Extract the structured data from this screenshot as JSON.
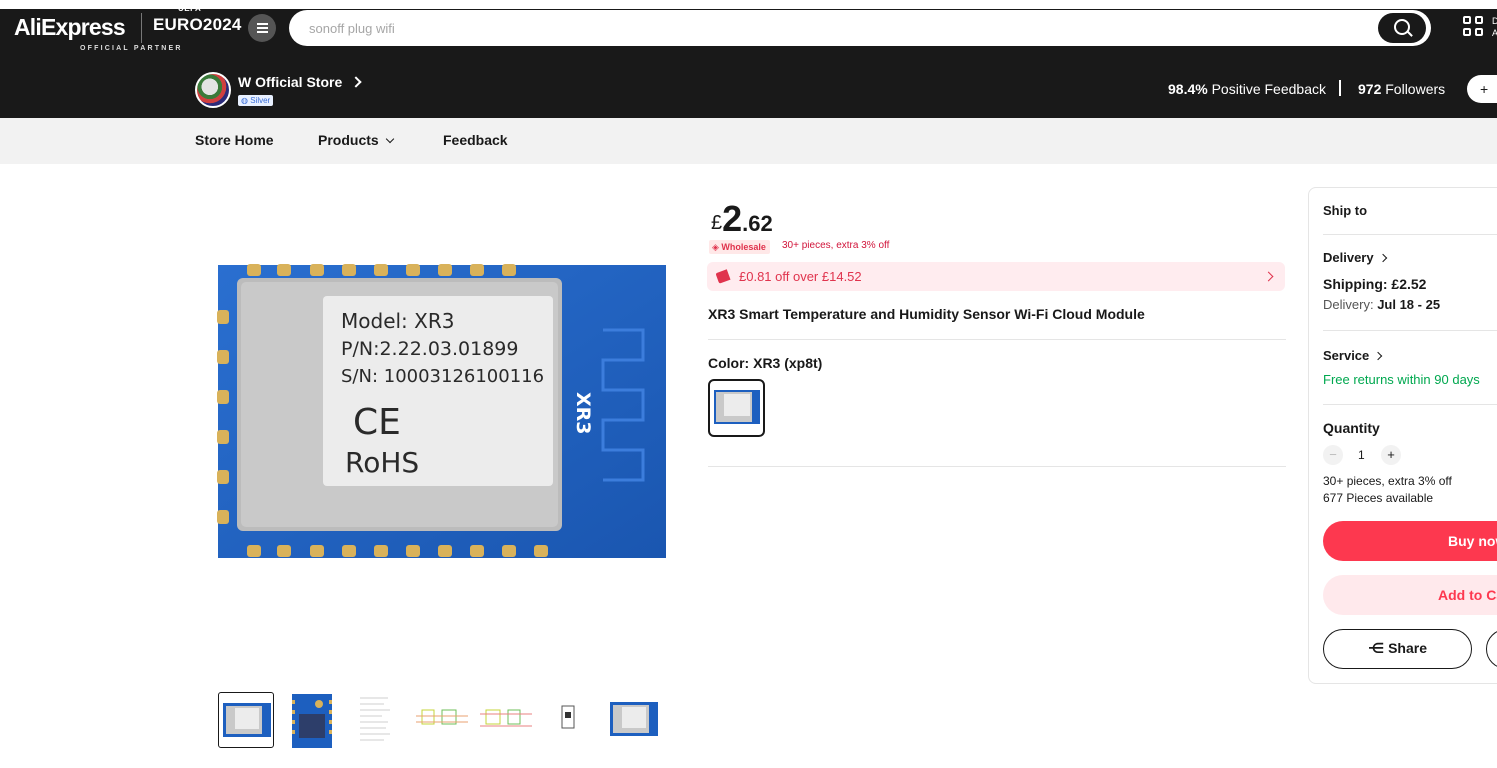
{
  "header": {
    "logo": "AliExpress",
    "euro": "EURO2024",
    "uefa": "UEFA",
    "partner": "OFFICIAL PARTNER",
    "search_placeholder": "sonoff plug wifi",
    "qr_text": "D A"
  },
  "store": {
    "name": "W Official Store",
    "badge": "Silver",
    "positive_feedback_value": "98.4%",
    "positive_feedback_label": "Positive Feedback",
    "followers_value": "972",
    "followers_label": "Followers",
    "follow_label": "+"
  },
  "nav": {
    "store_home": "Store Home",
    "products": "Products",
    "feedback": "Feedback"
  },
  "product": {
    "currency": "£",
    "price_int": "2",
    "price_dec": ".62",
    "wholesale_badge": "Wholesale",
    "wholesale_text": "30+ pieces, extra 3% off",
    "coupon_text": "£0.81 off over £14.52",
    "title": "XR3 Smart Temperature and Humidity Sensor Wi-Fi Cloud Module",
    "color_label": "Color: XR3 (xp8t)",
    "image_text": {
      "model": "Model: XR3",
      "pn": "P/N:2.22.03.01899",
      "sn": "S/N: 10003126100116",
      "ce": "CE",
      "rohs": "RoHS",
      "side": "XR3"
    }
  },
  "panel": {
    "ship_to": "Ship to",
    "delivery_label": "Delivery",
    "shipping": "Shipping: £2.52",
    "delivery_prefix": "Delivery: ",
    "delivery_dates": "Jul 18 - 25",
    "service_label": "Service",
    "free_returns": "Free returns within 90 days",
    "quantity_label": "Quantity",
    "quantity_value": "1",
    "minus": "−",
    "plus": "+",
    "bulk_text": "30+ pieces, extra 3% off",
    "available": "677 Pieces available",
    "buy_now": "Buy now",
    "add_to_cart": "Add to Cart",
    "share": "Share"
  },
  "colors": {
    "accent": "#fd384f",
    "green": "#00a84f",
    "dark": "#191919"
  }
}
